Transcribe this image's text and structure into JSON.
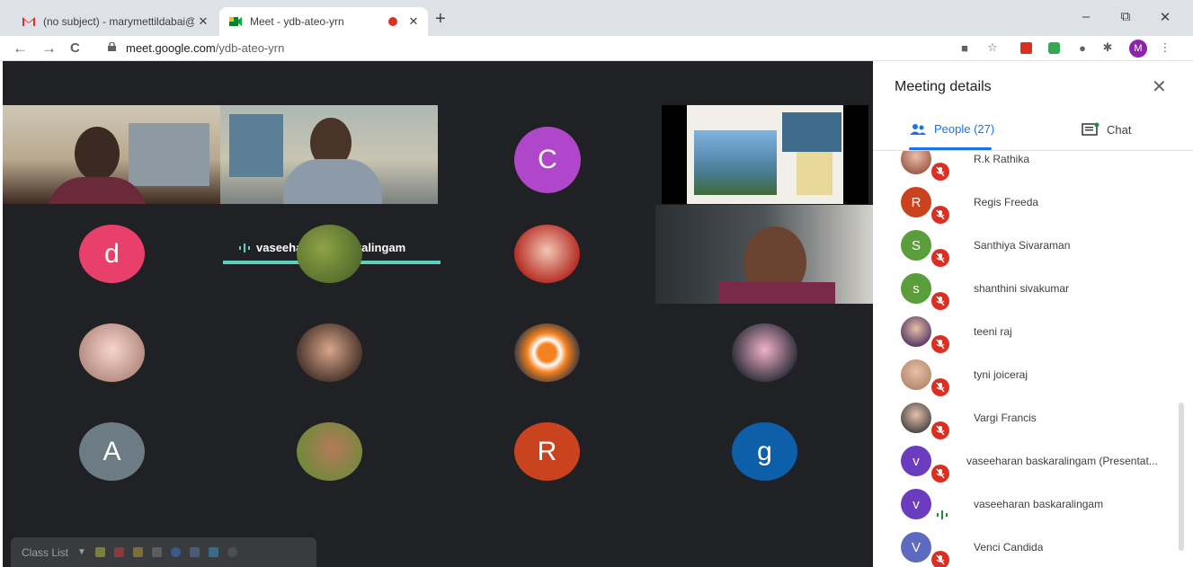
{
  "browser": {
    "tabs": [
      {
        "title": "(no subject) - marymettildabai@",
        "icon": "gmail-icon"
      },
      {
        "title": "Meet - ydb-ateo-yrn",
        "icon": "meet-icon"
      }
    ],
    "new_tab_label": "+",
    "window_controls": {
      "minimize": "–",
      "restore": "⧉",
      "close": "✕"
    },
    "nav": {
      "back": "←",
      "forward": "→",
      "reload": "C"
    },
    "url_host": "meet.google.com",
    "url_path": "/ydb-ateo-yrn",
    "profile_initial": "M"
  },
  "meeting": {
    "presenter_name": "vaseeharan baskaralingam",
    "tiles": [
      {
        "kind": "letter",
        "letter": "C",
        "color": "#b046c9"
      },
      {
        "kind": "letter",
        "letter": "d",
        "color": "#e8406b"
      },
      {
        "kind": "letter",
        "letter": "A",
        "color": "#6d7b85"
      },
      {
        "kind": "letter",
        "letter": "R",
        "color": "#c9431f"
      },
      {
        "kind": "letter",
        "letter": "g",
        "color": "#0c5fa8"
      }
    ]
  },
  "class_list": {
    "label": "Class List"
  },
  "panel": {
    "title": "Meeting details",
    "close_label": "✕",
    "people_tab": "People (27)",
    "chat_tab": "Chat",
    "people": [
      {
        "name": "R.k Rathika",
        "avatar": "photo",
        "color": "#a15c4a",
        "status": "muted"
      },
      {
        "name": "Regis Freeda",
        "avatar": "letter",
        "letter": "R",
        "color": "#c9431f",
        "status": "muted"
      },
      {
        "name": "Santhiya Sivaraman",
        "avatar": "letter",
        "letter": "S",
        "color": "#5b9d3a",
        "status": "muted"
      },
      {
        "name": "shanthini sivakumar",
        "avatar": "letter",
        "letter": "s",
        "color": "#5b9d3a",
        "status": "muted"
      },
      {
        "name": "teeni raj",
        "avatar": "photo",
        "color": "#5a3b66",
        "status": "muted"
      },
      {
        "name": "tyni joiceraj",
        "avatar": "photo",
        "color": "#b58a6f",
        "status": "muted"
      },
      {
        "name": "Vargi Francis",
        "avatar": "photo",
        "color": "#4a4a4a",
        "status": "muted"
      },
      {
        "name": "vaseeharan baskaralingam (Presentat...",
        "avatar": "letter",
        "letter": "v",
        "color": "#6a3cbf",
        "status": "muted"
      },
      {
        "name": "vaseeharan baskaralingam",
        "avatar": "letter",
        "letter": "v",
        "color": "#6a3cbf",
        "status": "speaking"
      },
      {
        "name": "Venci Candida",
        "avatar": "letter",
        "letter": "V",
        "color": "#5c6bc0",
        "status": "muted"
      }
    ]
  }
}
